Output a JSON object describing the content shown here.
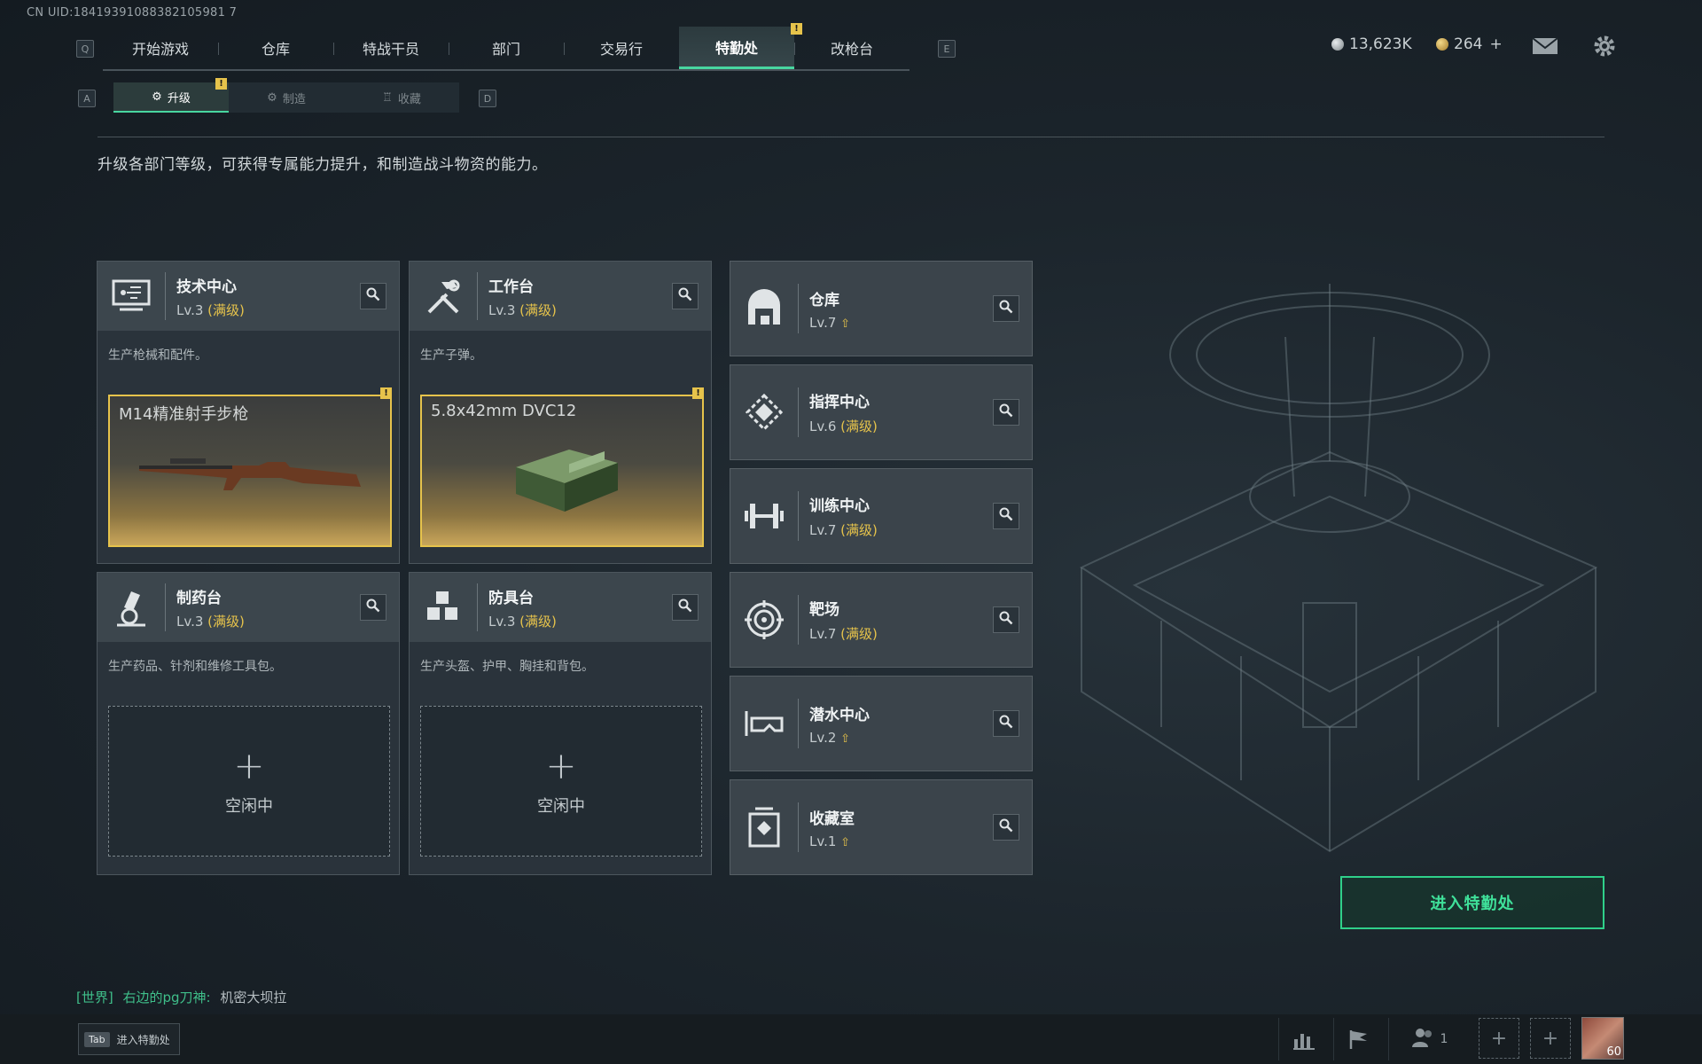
{
  "header": {
    "uid": "CN UID:18419391088382105981 7",
    "nav_left_key": "Q",
    "nav_right_key": "E",
    "tabs": [
      {
        "label": "开始游戏"
      },
      {
        "label": "仓库"
      },
      {
        "label": "特战干员"
      },
      {
        "label": "部门"
      },
      {
        "label": "交易行"
      },
      {
        "label": "特勤处"
      },
      {
        "label": "改枪台"
      }
    ],
    "active_tab": "特勤处",
    "currency1": "13,623K",
    "currency2": "264",
    "currency2_plus": "+"
  },
  "subnav": {
    "left_key": "A",
    "right_key": "D",
    "tabs": [
      {
        "label": "升级"
      },
      {
        "label": "制造"
      },
      {
        "label": "收藏"
      }
    ],
    "active": "升级"
  },
  "description": "升级各部门等级，可获得专属能力提升，和制造战斗物资的能力。",
  "production_cards": [
    {
      "title": "技术中心",
      "level": "Lv.3",
      "max": "(满级)",
      "desc": "生产枪械和配件。",
      "slot_status": "item",
      "slot_item": "M14精准射手步枪",
      "icon": "tech-center-icon"
    },
    {
      "title": "工作台",
      "level": "Lv.3",
      "max": "(满级)",
      "desc": "生产子弹。",
      "slot_status": "item",
      "slot_item": "5.8x42mm DVC12",
      "icon": "workbench-icon"
    },
    {
      "title": "制药台",
      "level": "Lv.3",
      "max": "(满级)",
      "desc": "生产药品、针剂和维修工具包。",
      "slot_status": "empty",
      "slot_item": "空闲中",
      "icon": "pharmacy-icon"
    },
    {
      "title": "防具台",
      "level": "Lv.3",
      "max": "(满级)",
      "desc": "生产头盔、护甲、胸挂和背包。",
      "slot_status": "empty",
      "slot_item": "空闲中",
      "icon": "armor-bench-icon"
    }
  ],
  "facilities": [
    {
      "title": "仓库",
      "level": "Lv.7",
      "max": "",
      "upgradable": true,
      "icon": "warehouse-icon"
    },
    {
      "title": "指挥中心",
      "level": "Lv.6",
      "max": "(满级)",
      "upgradable": false,
      "icon": "command-center-icon"
    },
    {
      "title": "训练中心",
      "level": "Lv.7",
      "max": "(满级)",
      "upgradable": false,
      "icon": "training-center-icon"
    },
    {
      "title": "靶场",
      "level": "Lv.7",
      "max": "(满级)",
      "upgradable": false,
      "icon": "shooting-range-icon"
    },
    {
      "title": "潜水中心",
      "level": "Lv.2",
      "max": "",
      "upgradable": true,
      "icon": "diving-center-icon"
    },
    {
      "title": "收藏室",
      "level": "Lv.1",
      "max": "",
      "upgradable": true,
      "icon": "collection-room-icon"
    }
  ],
  "enter_button": "进入特勤处",
  "chat": {
    "channel": "[世界]",
    "user": "右边的pg刀神:",
    "message": "机密大坝拉"
  },
  "bottom": {
    "tab_key": "Tab",
    "tab_label": "进入特勤处",
    "friends_count": "1",
    "avatar_level": "60"
  },
  "colors": {
    "accent_green": "#48d6a0",
    "max_level_gold": "#e6c34b",
    "enter_button": "#2fd08a"
  }
}
